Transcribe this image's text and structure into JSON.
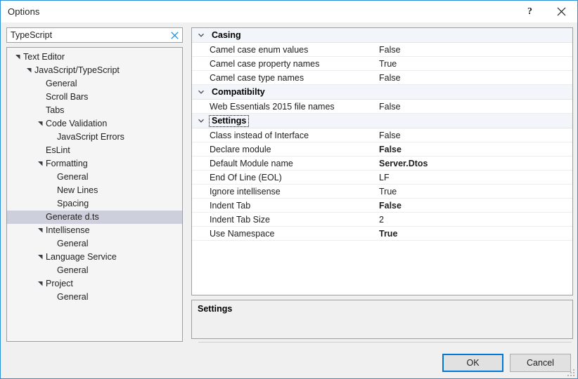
{
  "window": {
    "title": "Options",
    "help_icon": "question-mark-icon",
    "close_icon": "close-icon",
    "accent_color": "#0078D7",
    "border_color": "#2F8FD8"
  },
  "search": {
    "value": "TypeScript",
    "placeholder": "Search Options",
    "clear_icon": "clear-x-icon",
    "clear_color": "#1F8DD6"
  },
  "tree": {
    "selected": "Generate d.ts",
    "selection_color": "#CDD0DC",
    "items": [
      {
        "label": "Text Editor",
        "depth": 0,
        "expandable": true,
        "expanded": true,
        "selected": false
      },
      {
        "label": "JavaScript/TypeScript",
        "depth": 1,
        "expandable": true,
        "expanded": true,
        "selected": false
      },
      {
        "label": "General",
        "depth": 2,
        "expandable": false,
        "expanded": false,
        "selected": false
      },
      {
        "label": "Scroll Bars",
        "depth": 2,
        "expandable": false,
        "expanded": false,
        "selected": false
      },
      {
        "label": "Tabs",
        "depth": 2,
        "expandable": false,
        "expanded": false,
        "selected": false
      },
      {
        "label": "Code Validation",
        "depth": 2,
        "expandable": true,
        "expanded": true,
        "selected": false
      },
      {
        "label": "JavaScript Errors",
        "depth": 3,
        "expandable": false,
        "expanded": false,
        "selected": false
      },
      {
        "label": "EsLint",
        "depth": 2,
        "expandable": false,
        "expanded": false,
        "selected": false
      },
      {
        "label": "Formatting",
        "depth": 2,
        "expandable": true,
        "expanded": true,
        "selected": false
      },
      {
        "label": "General",
        "depth": 3,
        "expandable": false,
        "expanded": false,
        "selected": false
      },
      {
        "label": "New Lines",
        "depth": 3,
        "expandable": false,
        "expanded": false,
        "selected": false
      },
      {
        "label": "Spacing",
        "depth": 3,
        "expandable": false,
        "expanded": false,
        "selected": false
      },
      {
        "label": "Generate d.ts",
        "depth": 2,
        "expandable": false,
        "expanded": false,
        "selected": true
      },
      {
        "label": "Intellisense",
        "depth": 2,
        "expandable": true,
        "expanded": true,
        "selected": false
      },
      {
        "label": "General",
        "depth": 3,
        "expandable": false,
        "expanded": false,
        "selected": false
      },
      {
        "label": "Language Service",
        "depth": 2,
        "expandable": true,
        "expanded": true,
        "selected": false
      },
      {
        "label": "General",
        "depth": 3,
        "expandable": false,
        "expanded": false,
        "selected": false
      },
      {
        "label": "Project",
        "depth": 2,
        "expandable": true,
        "expanded": true,
        "selected": false
      },
      {
        "label": "General",
        "depth": 3,
        "expandable": false,
        "expanded": false,
        "selected": false
      }
    ]
  },
  "property_grid": {
    "header_bg": "#F2F5F9",
    "categories": [
      {
        "name": "Casing",
        "expanded": true,
        "focused": false,
        "properties": [
          {
            "name": "Camel case enum values",
            "value": "False",
            "modified": false
          },
          {
            "name": "Camel case property names",
            "value": "True",
            "modified": false
          },
          {
            "name": "Camel case type names",
            "value": "False",
            "modified": false
          }
        ]
      },
      {
        "name": "Compatibilty",
        "expanded": true,
        "focused": false,
        "properties": [
          {
            "name": "Web Essentials 2015 file names",
            "value": "False",
            "modified": false
          }
        ]
      },
      {
        "name": "Settings",
        "expanded": true,
        "focused": true,
        "properties": [
          {
            "name": "Class instead of Interface",
            "value": "False",
            "modified": false
          },
          {
            "name": "Declare module",
            "value": "False",
            "modified": true
          },
          {
            "name": "Default Module name",
            "value": "Server.Dtos",
            "modified": true
          },
          {
            "name": "End Of Line (EOL)",
            "value": "LF",
            "modified": false
          },
          {
            "name": "Ignore intellisense",
            "value": "True",
            "modified": false
          },
          {
            "name": "Indent Tab",
            "value": "False",
            "modified": true
          },
          {
            "name": "Indent Tab Size",
            "value": "2",
            "modified": false
          },
          {
            "name": "Use Namespace",
            "value": "True",
            "modified": true
          }
        ]
      }
    ]
  },
  "description": {
    "title": "Settings",
    "text": ""
  },
  "buttons": {
    "ok": "OK",
    "cancel": "Cancel",
    "default": "OK"
  }
}
